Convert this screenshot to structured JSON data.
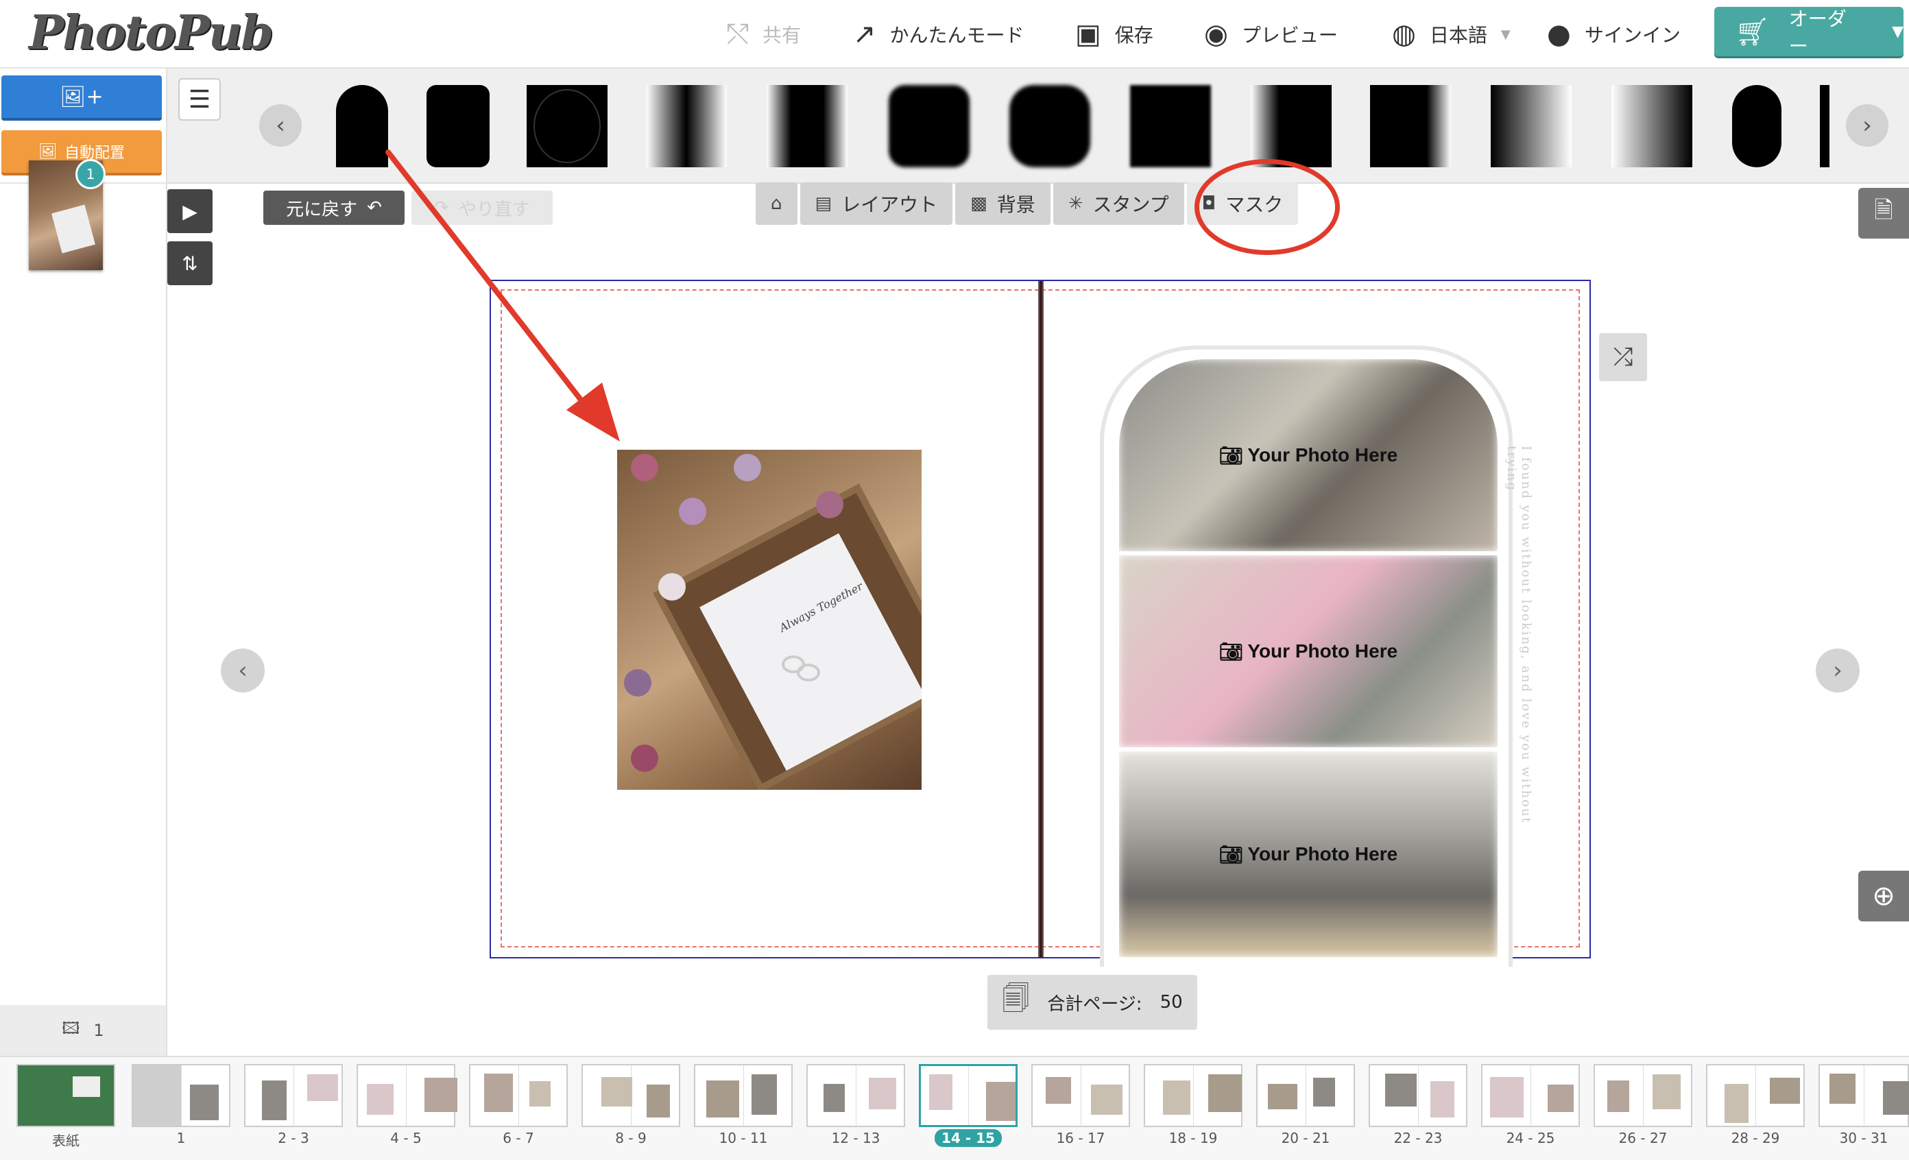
{
  "header": {
    "logo": "PhotoPub",
    "share": "共有",
    "easy_mode": "かんたんモード",
    "save": "保存",
    "preview": "プレビュー",
    "language": "日本語",
    "signin": "サインイン",
    "order": "オーダー"
  },
  "sidebar": {
    "auto_layout": "自動配置",
    "photo_badge": "1",
    "photo_count": "1"
  },
  "toolbar": {
    "undo": "元に戻す",
    "redo": "やり直す",
    "tabs": {
      "layout": "レイアウト",
      "background": "背景",
      "stamp": "スタンプ",
      "mask": "マスク"
    }
  },
  "canvas": {
    "card_text": "Always Together",
    "photo_placeholder": "Your Photo Here",
    "vertical_text": "I found you without looking, and love you without trying",
    "total_pages_label": "合計ページ:",
    "total_pages_value": "50"
  },
  "page_strip": {
    "pages": [
      {
        "label": "表紙"
      },
      {
        "label": "1"
      },
      {
        "label": "2 - 3"
      },
      {
        "label": "4 - 5"
      },
      {
        "label": "6 - 7"
      },
      {
        "label": "8 - 9"
      },
      {
        "label": "10 - 11"
      },
      {
        "label": "12 - 13"
      },
      {
        "label": "14 - 15"
      },
      {
        "label": "16 - 17"
      },
      {
        "label": "18 - 19"
      },
      {
        "label": "20 - 21"
      },
      {
        "label": "22 - 23"
      },
      {
        "label": "24 - 25"
      },
      {
        "label": "26 - 27"
      },
      {
        "label": "28 - 29"
      },
      {
        "label": "30 - 31"
      }
    ],
    "selected_page": "14 - 15"
  },
  "colors": {
    "accent_teal": "#4aa8a2",
    "add_photo_blue": "#2f7fd6",
    "auto_orange": "#f19a3e",
    "annotation_red": "#e13a2b"
  }
}
